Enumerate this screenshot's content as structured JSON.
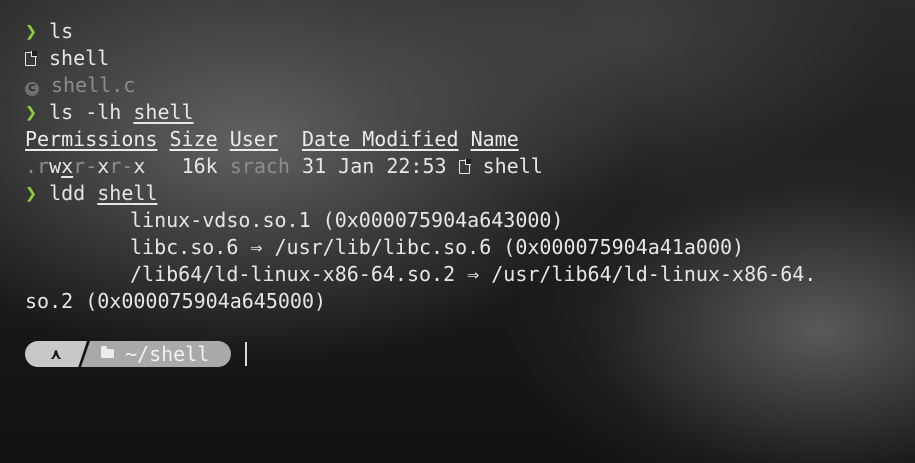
{
  "prompt_glyph": "❯",
  "lines": {
    "cmd1": "ls",
    "file1": "shell",
    "file2": "shell.c",
    "cmd2_prefix": "ls -lh ",
    "cmd2_arg": "shell",
    "header": {
      "permissions": "Permissions",
      "size": "Size",
      "user": "User",
      "date": "Date Modified",
      "name": "Name"
    },
    "row": {
      "perm_prefix": ".",
      "perm_r1": "r",
      "perm_w": "w",
      "perm_x1": "x",
      "perm_r2": "r",
      "perm_sep": "-",
      "perm_x2": "x",
      "perm_r3": "r",
      "perm_sep2": "-",
      "perm_x3": "x",
      "size": "16k",
      "user": "srach",
      "date": "31 Jan 22:53",
      "name": "shell"
    },
    "cmd3_prefix": "ldd ",
    "cmd3_arg": "shell",
    "ldd1": "linux-vdso.so.1 (0x000075904a643000)",
    "ldd2": "libc.so.6 ⇒ /usr/lib/libc.so.6 (0x000075904a41a000)",
    "ldd3": "/lib64/ld-linux-x86-64.so.2 ⇒ /usr/lib64/ld-linux-x86-64.",
    "ldd3_wrap": "so.2 (0x000075904a645000)"
  },
  "promptbar": {
    "os_glyph": "⋏",
    "directory": "~/shell"
  },
  "colors": {
    "prompt": "#8ccf3c",
    "dim": "#8c8c8c"
  }
}
